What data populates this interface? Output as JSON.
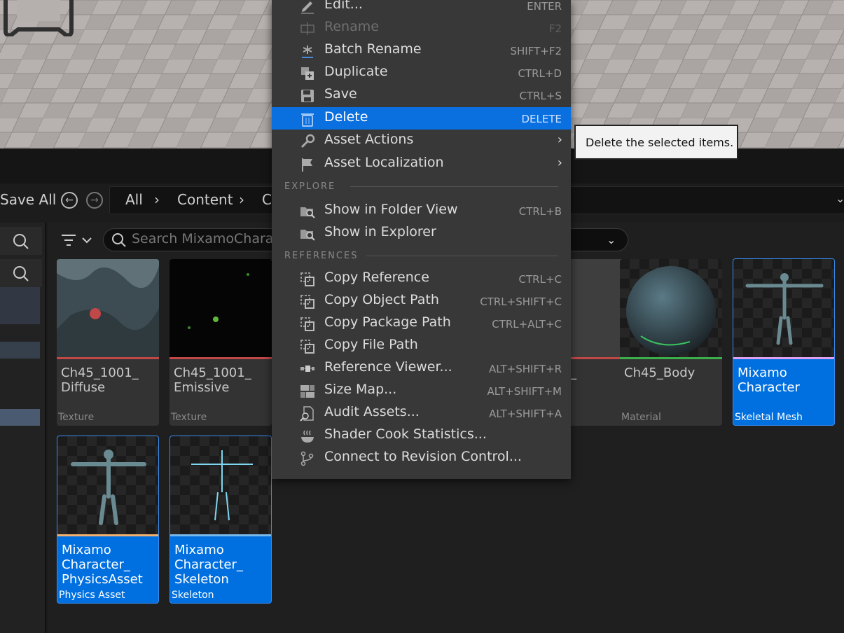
{
  "toolbar": {
    "save_all_label": "Save All",
    "breadcrumb": [
      "All",
      "Content",
      "C"
    ]
  },
  "search": {
    "placeholder": "Search MixamoCharac"
  },
  "menu": {
    "items": [
      {
        "label": "Edit...",
        "shortcut": "ENTER",
        "icon": "pencil-icon"
      },
      {
        "label": "Rename",
        "shortcut": "F2",
        "icon": "rename-icon",
        "disabled": true
      },
      {
        "label": "Batch Rename",
        "shortcut": "SHIFT+F2",
        "icon": "asterisk-icon"
      },
      {
        "label": "Duplicate",
        "shortcut": "CTRL+D",
        "icon": "duplicate-icon"
      },
      {
        "label": "Save",
        "shortcut": "CTRL+S",
        "icon": "save-icon"
      },
      {
        "label": "Delete",
        "shortcut": "DELETE",
        "icon": "trash-icon",
        "highlighted": true
      },
      {
        "label": "Asset Actions",
        "shortcut": "",
        "icon": "wrench-icon",
        "submenu": true
      },
      {
        "label": "Asset Localization",
        "shortcut": "",
        "icon": "flag-icon",
        "submenu": true
      }
    ],
    "explore_header": "EXPLORE",
    "explore_items": [
      {
        "label": "Show in Folder View",
        "shortcut": "CTRL+B",
        "icon": "folder-search-icon"
      },
      {
        "label": "Show in Explorer",
        "shortcut": "",
        "icon": "folder-search-icon"
      }
    ],
    "references_header": "REFERENCES",
    "reference_items": [
      {
        "label": "Copy Reference",
        "shortcut": "CTRL+C",
        "icon": "copy-icon"
      },
      {
        "label": "Copy Object Path",
        "shortcut": "CTRL+SHIFT+C",
        "icon": "copy-icon"
      },
      {
        "label": "Copy Package Path",
        "shortcut": "CTRL+ALT+C",
        "icon": "copy-icon"
      },
      {
        "label": "Copy File Path",
        "shortcut": "",
        "icon": "copy-icon"
      },
      {
        "label": "Reference Viewer...",
        "shortcut": "ALT+SHIFT+R",
        "icon": "graph-icon"
      },
      {
        "label": "Size Map...",
        "shortcut": "ALT+SHIFT+M",
        "icon": "sizemap-icon"
      },
      {
        "label": "Audit Assets...",
        "shortcut": "ALT+SHIFT+A",
        "icon": "audit-icon"
      },
      {
        "label": "Shader Cook Statistics...",
        "shortcut": "",
        "icon": "bowl-icon"
      },
      {
        "label": "Connect to Revision Control...",
        "shortcut": "",
        "icon": "branch-icon"
      }
    ]
  },
  "tooltip": {
    "text": "Delete the selected items."
  },
  "assets": [
    {
      "name": "Ch45_1001_\nDiffuse",
      "type": "Texture",
      "stripe": "#c24848",
      "selected": false
    },
    {
      "name": "Ch45_1001_\nEmissive",
      "type": "Texture",
      "stripe": "#c24848",
      "selected": false
    },
    {
      "name": "_",
      "type": "",
      "stripe": "#c24848",
      "selected": false
    },
    {
      "name": "Ch45_Body",
      "type": "Material",
      "stripe": "#3ab04a",
      "selected": false
    },
    {
      "name": "Mixamo\nCharacter",
      "type": "Skeletal Mesh",
      "stripe": "#e0a0f0",
      "selected": true
    },
    {
      "name": "Mixamo\nCharacter_\nPhysicsAsset",
      "type": "Physics Asset",
      "stripe": "#f0b070",
      "selected": true
    },
    {
      "name": "Mixamo\nCharacter_\nSkeleton",
      "type": "Skeleton",
      "stripe": "#7ab8e8",
      "selected": true
    }
  ],
  "colors": {
    "highlight": "#0a70e0",
    "menu_bg": "#383838",
    "selected_tile": "#0070e0"
  }
}
